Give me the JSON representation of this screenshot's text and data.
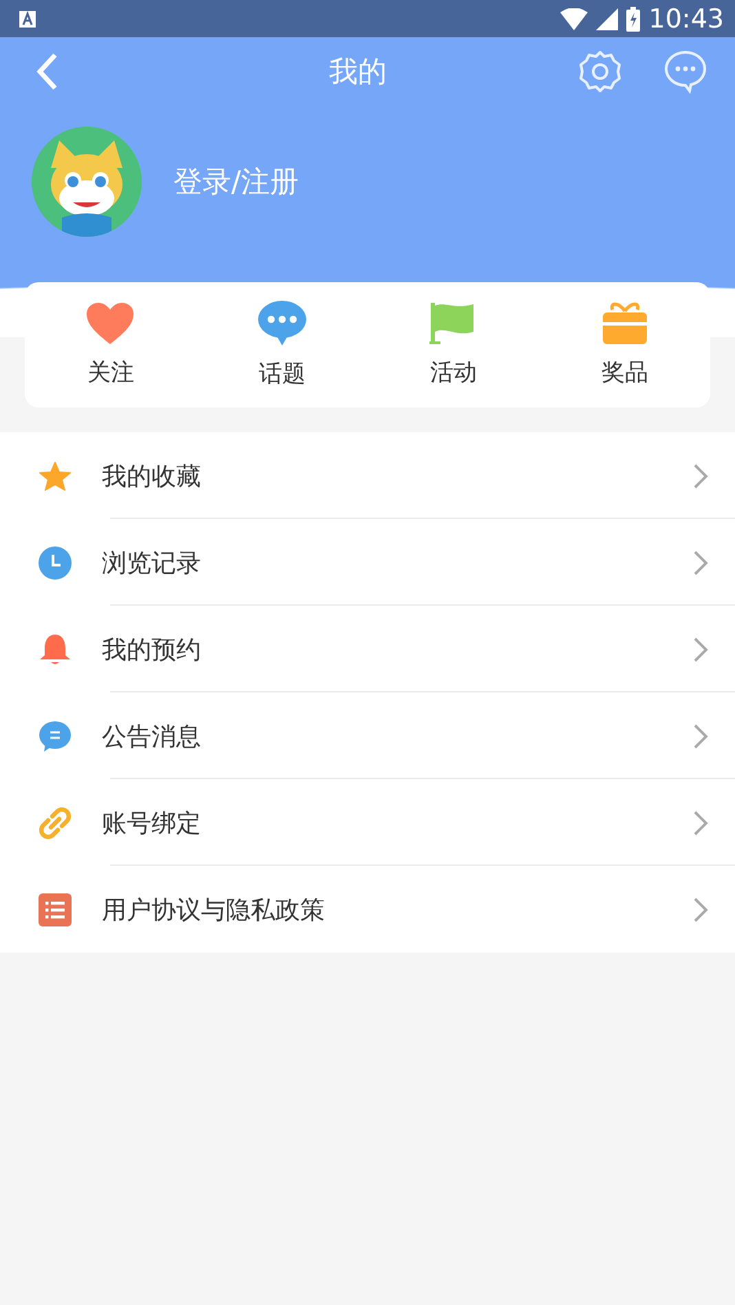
{
  "status_bar": {
    "time": "10:43"
  },
  "nav": {
    "title": "我的"
  },
  "profile": {
    "login_label": "登录/注册"
  },
  "shortcuts": [
    {
      "kind": "heart",
      "label": "关注"
    },
    {
      "kind": "chat",
      "label": "话题"
    },
    {
      "kind": "flag",
      "label": "活动"
    },
    {
      "kind": "gift",
      "label": "奖品"
    }
  ],
  "menu": [
    {
      "kind": "star",
      "label": "我的收藏"
    },
    {
      "kind": "clock",
      "label": "浏览记录"
    },
    {
      "kind": "bell",
      "label": "我的预约"
    },
    {
      "kind": "message",
      "label": "公告消息"
    },
    {
      "kind": "link",
      "label": "账号绑定"
    },
    {
      "kind": "list",
      "label": "用户协议与隐私政策"
    }
  ]
}
